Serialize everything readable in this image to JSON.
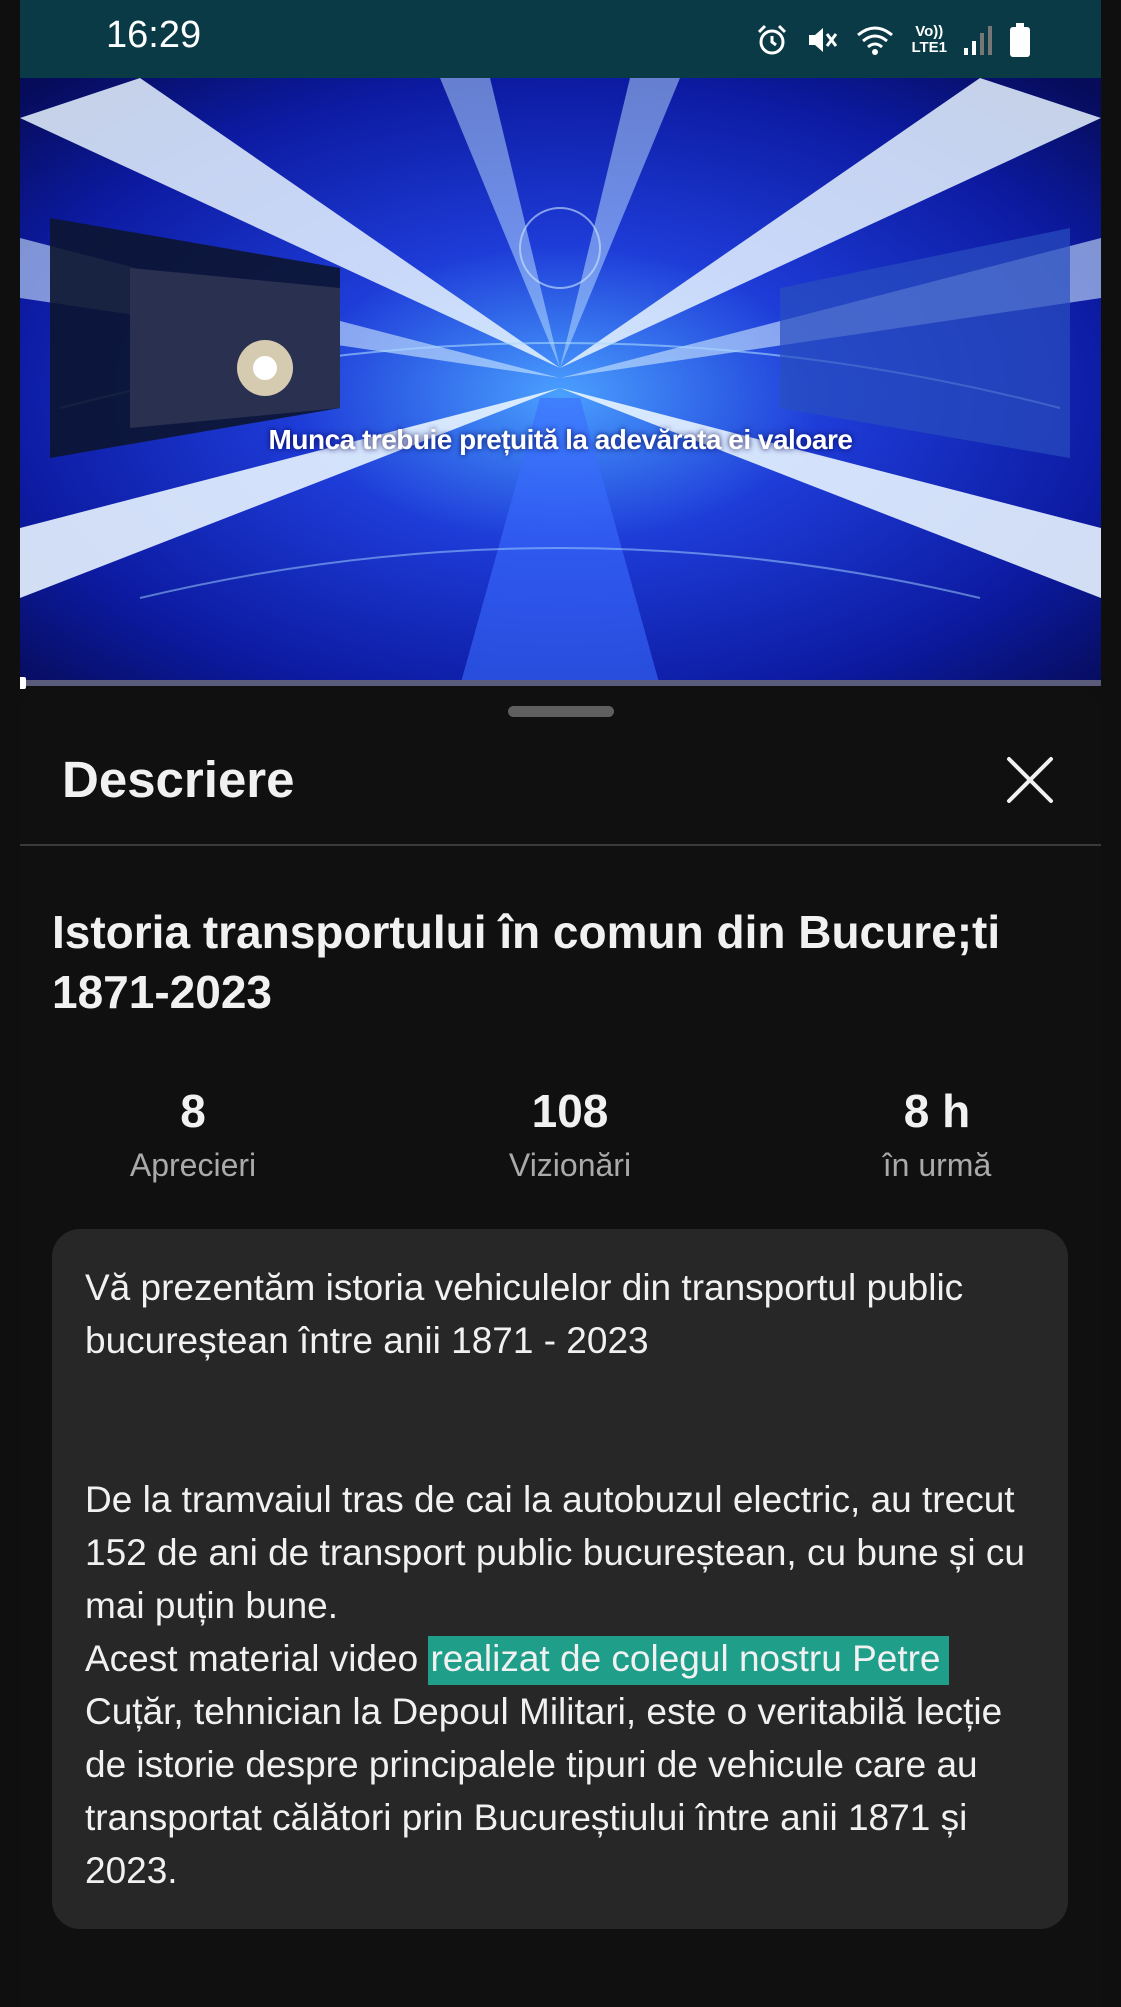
{
  "status_bar": {
    "time": "16:29",
    "network_label_top": "Vo))",
    "network_label_bottom": "LTE1",
    "icons": [
      "alarm-icon",
      "mute-icon",
      "wifi-icon",
      "signal-icon",
      "battery-icon"
    ]
  },
  "video": {
    "caption": "Munca trebuie prețuită la adevărata ei valoare",
    "progress_fraction": 0.002
  },
  "sheet": {
    "title": "Descriere",
    "close_icon": "close-icon"
  },
  "video_title": "Istoria transportului în comun din Bucure;ti 1871-2023",
  "stats": [
    {
      "value": "8",
      "label": "Aprecieri"
    },
    {
      "value": "108",
      "label": "Vizionări"
    },
    {
      "value": "8 h",
      "label": "în urmă"
    }
  ],
  "description": {
    "paragraph1": "Vă prezentăm istoria vehiculelor din transportul public bucureștean între anii 1871 - 2023",
    "paragraph2": "De la tramvaiul tras de cai la autobuzul electric, au trecut 152 de ani de transport public bucureștean, cu bune și cu mai puțin bune.",
    "paragraph3_before": "Acest material video ",
    "paragraph3_highlight": "realizat de colegul nostru Petre",
    "paragraph3_after": " Cuțăr, tehnician la Depoul Militari, este o veritabilă lecție de istorie despre principalele tipuri de vehicule care au transportat călători prin Bucureștiului între anii 1871 și 2023."
  },
  "colors": {
    "background": "#0f0f0f",
    "status_bar": "#0a3a46",
    "description_box": "#272727",
    "highlight": "#1f9e8a"
  }
}
